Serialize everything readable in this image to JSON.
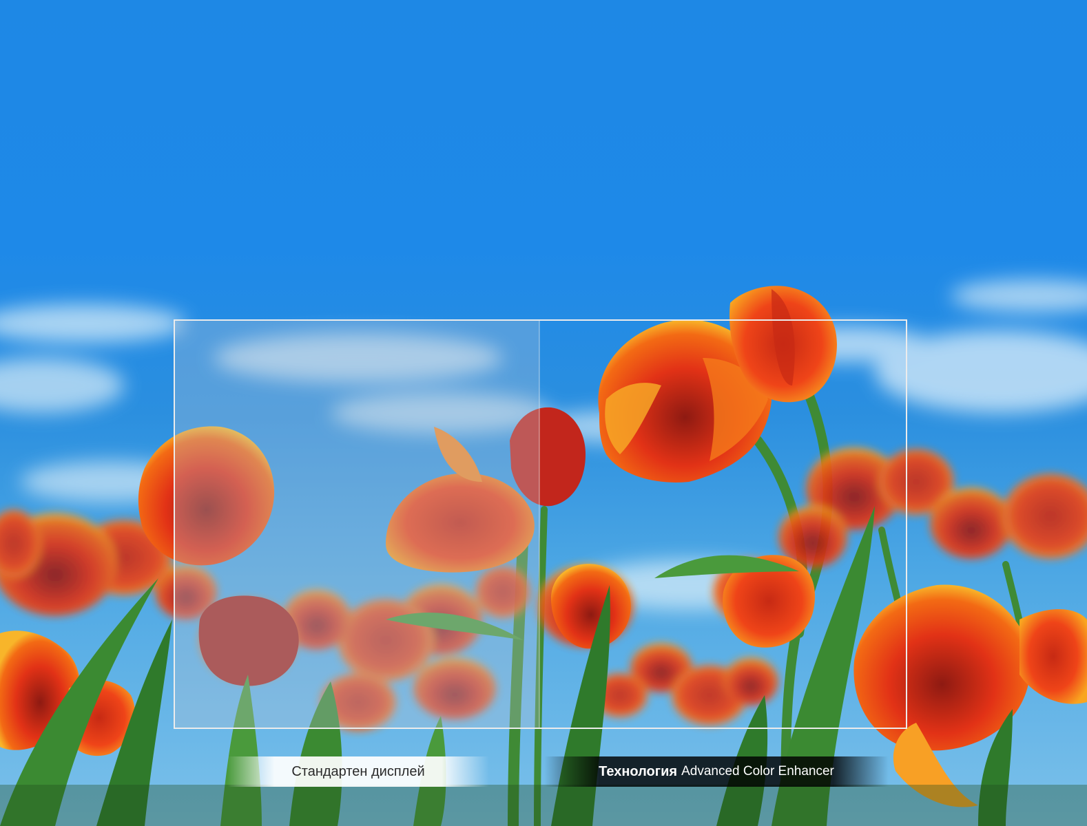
{
  "comparison": {
    "standard_label": "Стандартен дисплей",
    "enhanced_prefix": "Технология",
    "enhanced_name": "Advanced Color Enhancer"
  },
  "colors": {
    "sky_top": "#1e88e5",
    "sky_low": "#4aa3e0",
    "tulip_red": "#e8351a",
    "tulip_orange": "#f5a21b",
    "stem_green": "#3f8a35",
    "frame_stroke": "#ececec"
  }
}
